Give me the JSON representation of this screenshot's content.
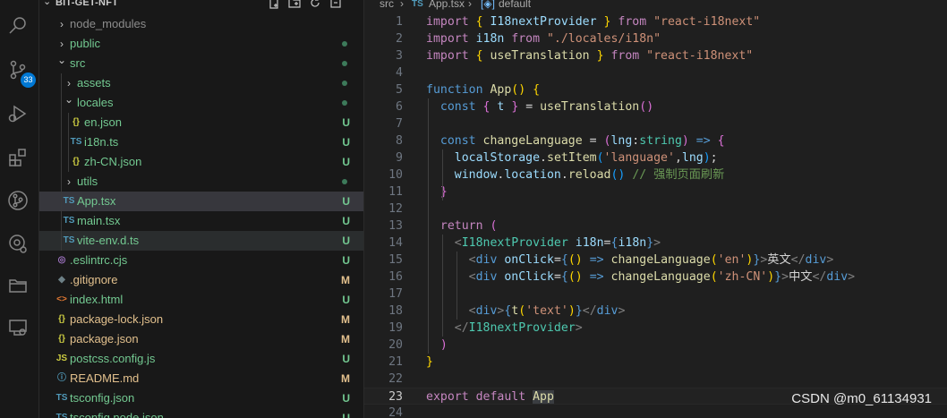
{
  "activity_bar": {
    "scm_badge": "33",
    "icons": [
      "search-icon",
      "source-control-icon",
      "run-debug-icon",
      "extensions-icon",
      "git-graph-icon",
      "github-icon",
      "folder-icon",
      "remote-explorer-icon"
    ]
  },
  "explorer": {
    "project_title": "BIT-GET-NFT",
    "tree": [
      {
        "name": "node_modules",
        "type": "folder",
        "state": "collapsed",
        "status": "",
        "color": "ignored"
      },
      {
        "name": "public",
        "type": "folder",
        "state": "collapsed",
        "status": "dot",
        "color": "untracked"
      },
      {
        "name": "src",
        "type": "folder",
        "state": "expanded",
        "status": "dot",
        "color": "untracked"
      },
      {
        "name": "assets",
        "type": "folder",
        "state": "collapsed",
        "status": "dot",
        "color": "untracked"
      },
      {
        "name": "locales",
        "type": "folder",
        "state": "expanded",
        "status": "dot",
        "color": "untracked"
      },
      {
        "name": "en.json",
        "type": "json",
        "status": "U",
        "color": "untracked"
      },
      {
        "name": "i18n.ts",
        "type": "ts",
        "status": "U",
        "color": "untracked"
      },
      {
        "name": "zh-CN.json",
        "type": "json",
        "status": "U",
        "color": "untracked"
      },
      {
        "name": "utils",
        "type": "folder",
        "state": "collapsed",
        "status": "dot",
        "color": "untracked"
      },
      {
        "name": "App.tsx",
        "type": "ts",
        "status": "U",
        "color": "untracked"
      },
      {
        "name": "main.tsx",
        "type": "ts",
        "status": "U",
        "color": "untracked"
      },
      {
        "name": "vite-env.d.ts",
        "type": "ts",
        "status": "U",
        "color": "untracked"
      },
      {
        "name": ".eslintrc.cjs",
        "type": "eslint",
        "status": "U",
        "color": "untracked"
      },
      {
        "name": ".gitignore",
        "type": "git",
        "status": "M",
        "color": "mod"
      },
      {
        "name": "index.html",
        "type": "html",
        "status": "U",
        "color": "untracked"
      },
      {
        "name": "package-lock.json",
        "type": "json",
        "status": "M",
        "color": "mod"
      },
      {
        "name": "package.json",
        "type": "json",
        "status": "M",
        "color": "mod"
      },
      {
        "name": "postcss.config.js",
        "type": "js",
        "status": "U",
        "color": "untracked"
      },
      {
        "name": "README.md",
        "type": "info",
        "status": "M",
        "color": "mod"
      },
      {
        "name": "tsconfig.json",
        "type": "tsconfig",
        "status": "U",
        "color": "untracked"
      },
      {
        "name": "tsconfig.node.json",
        "type": "tsconfig",
        "status": "U",
        "color": "untracked"
      }
    ],
    "icon_glyphs": {
      "json": "{}",
      "ts": "TS",
      "eslint": "◎",
      "git": "◆",
      "html": "<>",
      "js": "JS",
      "info": "ⓘ",
      "tsconfig": "TS"
    }
  },
  "breadcrumb": {
    "folder": "src",
    "file_icon": "TS",
    "file": "App.tsx",
    "symbol": "default"
  },
  "code": {
    "current_line": 23,
    "lines": [
      [
        [
          "kc",
          "import "
        ],
        [
          "b1",
          "{ "
        ],
        [
          "vr",
          "I18nextProvider "
        ],
        [
          "b1",
          "}"
        ],
        [
          "kc",
          " from "
        ],
        [
          "st",
          "\"react-i18next\""
        ]
      ],
      [
        [
          "kc",
          "import "
        ],
        [
          "vr",
          "i18n"
        ],
        [
          "kc",
          " from "
        ],
        [
          "st",
          "\"./locales/i18n\""
        ]
      ],
      [
        [
          "kc",
          "import "
        ],
        [
          "b1",
          "{ "
        ],
        [
          "fn",
          "useTranslation "
        ],
        [
          "b1",
          "}"
        ],
        [
          "kc",
          " from "
        ],
        [
          "st",
          "\"react-i18next\""
        ]
      ],
      [],
      [
        [
          "kw",
          "function "
        ],
        [
          "fn",
          "App"
        ],
        [
          "b1",
          "()"
        ],
        [
          "pn",
          " "
        ],
        [
          "b1",
          "{"
        ]
      ],
      [
        [
          "pn",
          "  "
        ],
        [
          "kw",
          "const "
        ],
        [
          "b2",
          "{ "
        ],
        [
          "vr",
          "t "
        ],
        [
          "b2",
          "}"
        ],
        [
          "pn",
          " = "
        ],
        [
          "fn",
          "useTranslation"
        ],
        [
          "b2",
          "()"
        ]
      ],
      [],
      [
        [
          "pn",
          "  "
        ],
        [
          "kw",
          "const "
        ],
        [
          "fn",
          "changeLanguage"
        ],
        [
          "pn",
          " = "
        ],
        [
          "b2",
          "("
        ],
        [
          "vr",
          "lng"
        ],
        [
          "pn",
          ":"
        ],
        [
          "ty",
          "string"
        ],
        [
          "b2",
          ")"
        ],
        [
          "pn",
          " "
        ],
        [
          "kw",
          "=>"
        ],
        [
          "pn",
          " "
        ],
        [
          "b2",
          "{"
        ]
      ],
      [
        [
          "pn",
          "    "
        ],
        [
          "vr",
          "localStorage"
        ],
        [
          "pn",
          "."
        ],
        [
          "fn",
          "setItem"
        ],
        [
          "b3",
          "("
        ],
        [
          "st",
          "'language'"
        ],
        [
          "pn",
          ","
        ],
        [
          "vr",
          "lng"
        ],
        [
          "b3",
          ")"
        ],
        [
          "pn",
          ";"
        ]
      ],
      [
        [
          "pn",
          "    "
        ],
        [
          "vr",
          "window"
        ],
        [
          "pn",
          "."
        ],
        [
          "vr",
          "location"
        ],
        [
          "pn",
          "."
        ],
        [
          "fn",
          "reload"
        ],
        [
          "b3",
          "()"
        ],
        [
          "pn",
          " "
        ],
        [
          "cm",
          "// 强制页面刷新"
        ]
      ],
      [
        [
          "pn",
          "  "
        ],
        [
          "b2",
          "}"
        ]
      ],
      [],
      [
        [
          "pn",
          "  "
        ],
        [
          "kc",
          "return "
        ],
        [
          "b2",
          "("
        ]
      ],
      [
        [
          "pn",
          "    "
        ],
        [
          "tg",
          "<"
        ],
        [
          "ty",
          "I18nextProvider "
        ],
        [
          "vr",
          "i18n"
        ],
        [
          "pn",
          "="
        ],
        [
          "kw",
          "{"
        ],
        [
          "vr",
          "i18n"
        ],
        [
          "kw",
          "}"
        ],
        [
          "tg",
          ">"
        ]
      ],
      [
        [
          "pn",
          "      "
        ],
        [
          "tg",
          "<"
        ],
        [
          "kw",
          "div "
        ],
        [
          "vr",
          "onClick"
        ],
        [
          "pn",
          "="
        ],
        [
          "kw",
          "{"
        ],
        [
          "b1",
          "()"
        ],
        [
          "pn",
          " "
        ],
        [
          "kw",
          "=>"
        ],
        [
          "pn",
          " "
        ],
        [
          "fn",
          "changeLanguage"
        ],
        [
          "b1",
          "("
        ],
        [
          "st",
          "'en'"
        ],
        [
          "b1",
          ")"
        ],
        [
          "kw",
          "}"
        ],
        [
          "tg",
          ">"
        ],
        [
          "pn",
          "英文"
        ],
        [
          "tg",
          "</"
        ],
        [
          "kw",
          "div"
        ],
        [
          "tg",
          ">"
        ]
      ],
      [
        [
          "pn",
          "      "
        ],
        [
          "tg",
          "<"
        ],
        [
          "kw",
          "div "
        ],
        [
          "vr",
          "onClick"
        ],
        [
          "pn",
          "="
        ],
        [
          "kw",
          "{"
        ],
        [
          "b1",
          "()"
        ],
        [
          "pn",
          " "
        ],
        [
          "kw",
          "=>"
        ],
        [
          "pn",
          " "
        ],
        [
          "fn",
          "changeLanguage"
        ],
        [
          "b1",
          "("
        ],
        [
          "st",
          "'zh-CN'"
        ],
        [
          "b1",
          ")"
        ],
        [
          "kw",
          "}"
        ],
        [
          "tg",
          ">"
        ],
        [
          "pn",
          "中文"
        ],
        [
          "tg",
          "</"
        ],
        [
          "kw",
          "div"
        ],
        [
          "tg",
          ">"
        ]
      ],
      [],
      [
        [
          "pn",
          "      "
        ],
        [
          "tg",
          "<"
        ],
        [
          "kw",
          "div"
        ],
        [
          "tg",
          ">"
        ],
        [
          "kw",
          "{"
        ],
        [
          "fn",
          "t"
        ],
        [
          "b1",
          "("
        ],
        [
          "st",
          "'text'"
        ],
        [
          "b1",
          ")"
        ],
        [
          "kw",
          "}"
        ],
        [
          "tg",
          "</"
        ],
        [
          "kw",
          "div"
        ],
        [
          "tg",
          ">"
        ]
      ],
      [
        [
          "pn",
          "    "
        ],
        [
          "tg",
          "</"
        ],
        [
          "ty",
          "I18nextProvider"
        ],
        [
          "tg",
          ">"
        ]
      ],
      [
        [
          "pn",
          "  "
        ],
        [
          "b2",
          ")"
        ]
      ],
      [
        [
          "b1",
          "}"
        ]
      ],
      [],
      [
        [
          "kc",
          "export "
        ],
        [
          "kc",
          "default "
        ],
        [
          "fn hl",
          "App"
        ]
      ],
      []
    ]
  },
  "watermark": "CSDN @m0_61134931",
  "colors": {
    "untracked": "#73c991",
    "modified": "#e2c08d",
    "accent": "#0078d4"
  }
}
